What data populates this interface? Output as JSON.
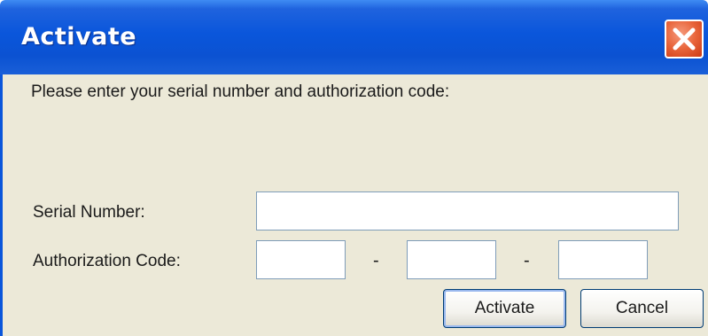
{
  "window": {
    "title": "Activate"
  },
  "content": {
    "prompt": "Please enter your serial number and authorization code:",
    "serial_label": "Serial Number:",
    "serial_value": "",
    "auth_label": "Authorization Code:",
    "auth_part1_value": "",
    "auth_separator_1": "-",
    "auth_part2_value": "",
    "auth_separator_2": "-",
    "auth_part3_value": ""
  },
  "buttons": {
    "activate_label": "Activate",
    "cancel_label": "Cancel"
  },
  "icons": {
    "close": "close-icon"
  },
  "colors": {
    "titlebar": "#0a56db",
    "dialog_background": "#ece9d8",
    "close_button": "#e8643a"
  }
}
